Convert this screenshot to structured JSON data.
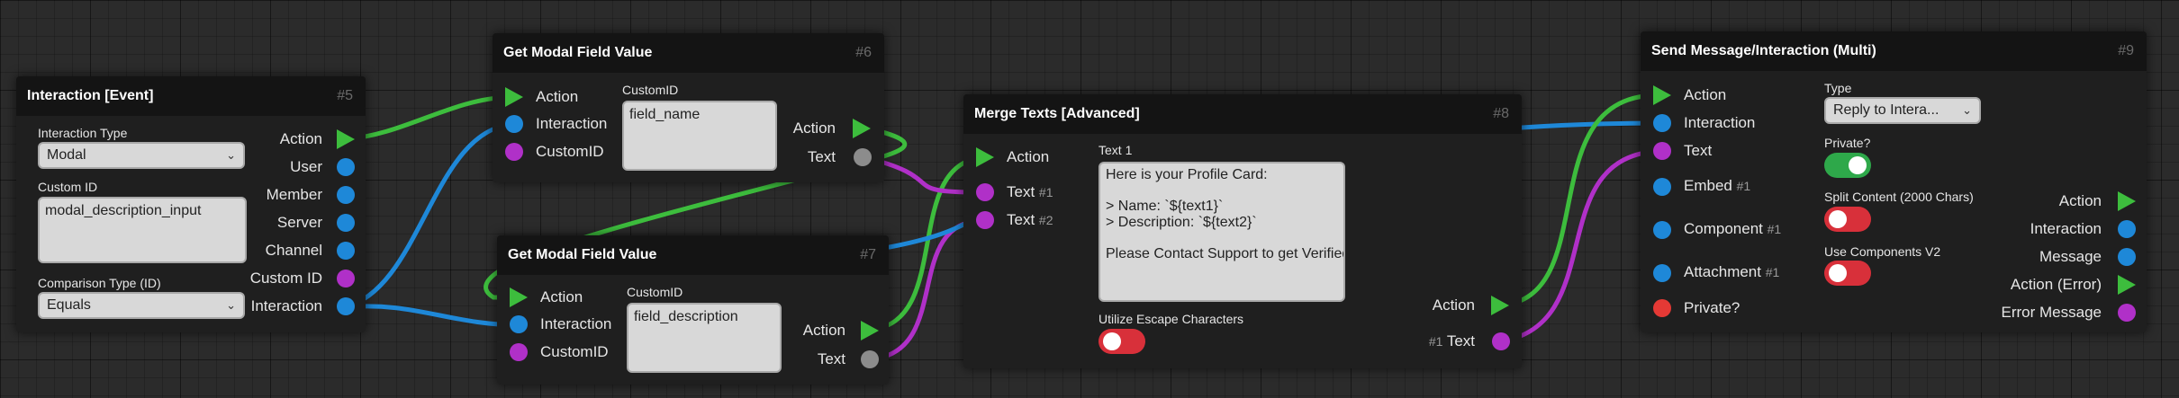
{
  "colors": {
    "action": "#3dbd3d",
    "interaction": "#1e88d8",
    "text": "#b030c8",
    "bool": "#e53935",
    "gray": "#8c8c8c",
    "toggle_on": "#2ea84a",
    "toggle_off": "#d8303a"
  },
  "n5": {
    "title": "Interaction [Event]",
    "id": "#5",
    "interaction_type_label": "Interaction Type",
    "interaction_type_value": "Modal",
    "custom_id_label": "Custom ID",
    "custom_id_value": "modal_description_input",
    "comparison_label": "Comparison Type (ID)",
    "comparison_value": "Equals",
    "outputs": [
      "Action",
      "User",
      "Member",
      "Server",
      "Channel",
      "Custom ID",
      "Interaction"
    ]
  },
  "n6": {
    "title": "Get Modal Field Value",
    "id": "#6",
    "inputs": [
      "Action",
      "Interaction",
      "CustomID"
    ],
    "customid_label": "CustomID",
    "customid_value": "field_name",
    "outputs": [
      "Action",
      "Text"
    ]
  },
  "n7": {
    "title": "Get Modal Field Value",
    "id": "#7",
    "inputs": [
      "Action",
      "Interaction",
      "CustomID"
    ],
    "customid_label": "CustomID",
    "customid_value": "field_description",
    "outputs": [
      "Action",
      "Text"
    ]
  },
  "n8": {
    "title": "Merge Texts [Advanced]",
    "id": "#8",
    "inputs": [
      {
        "label": "Action",
        "num": ""
      },
      {
        "label": "Text",
        "num": "#1"
      },
      {
        "label": "Text",
        "num": "#2"
      }
    ],
    "text1_label": "Text 1",
    "text1_value": "Here is your Profile Card:\n\n> Name: `${text1}`\n> Description: `${text2}`\n\nPlease Contact Support to get Verified!",
    "escape_label": "Utilize Escape Characters",
    "escape_on": false,
    "outputs": [
      {
        "label": "Action",
        "num": ""
      },
      {
        "label": "Text",
        "num": "#1"
      }
    ]
  },
  "n9": {
    "title": "Send Message/Interaction (Multi)",
    "id": "#9",
    "inputs": [
      {
        "label": "Action",
        "num": ""
      },
      {
        "label": "Interaction",
        "num": ""
      },
      {
        "label": "Text",
        "num": ""
      },
      {
        "label": "Embed",
        "num": "#1"
      },
      {
        "label": "Component",
        "num": "#1"
      },
      {
        "label": "Attachment",
        "num": "#1"
      },
      {
        "label": "Private?",
        "num": ""
      }
    ],
    "type_label": "Type",
    "type_value": "Reply to Intera...",
    "private_label": "Private?",
    "private_on": true,
    "split_label": "Split Content (2000 Chars)",
    "split_on": false,
    "components_label": "Use Components V2",
    "components_on": false,
    "outputs": [
      "Action",
      "Interaction",
      "Message",
      "Action (Error)",
      "Error Message"
    ]
  }
}
